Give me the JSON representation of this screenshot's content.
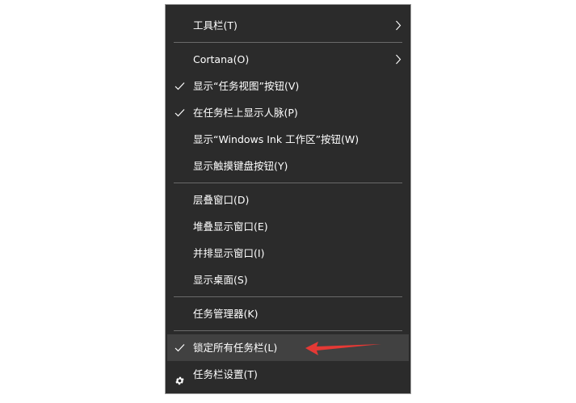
{
  "menu": {
    "groups": [
      [
        {
          "label": "工具栏(T)",
          "checked": false,
          "submenu": true
        }
      ],
      [
        {
          "label": "Cortana(O)",
          "checked": false,
          "submenu": true
        },
        {
          "label": "显示“任务视图”按钮(V)",
          "checked": true,
          "submenu": false
        },
        {
          "label": "在任务栏上显示人脉(P)",
          "checked": true,
          "submenu": false
        },
        {
          "label": "显示“Windows Ink 工作区”按钮(W)",
          "checked": false,
          "submenu": false
        },
        {
          "label": "显示触摸键盘按钮(Y)",
          "checked": false,
          "submenu": false
        }
      ],
      [
        {
          "label": "层叠窗口(D)",
          "checked": false,
          "submenu": false
        },
        {
          "label": "堆叠显示窗口(E)",
          "checked": false,
          "submenu": false
        },
        {
          "label": "并排显示窗口(I)",
          "checked": false,
          "submenu": false
        },
        {
          "label": "显示桌面(S)",
          "checked": false,
          "submenu": false
        }
      ],
      [
        {
          "label": "任务管理器(K)",
          "checked": false,
          "submenu": false
        }
      ],
      [
        {
          "label": "锁定所有任务栏(L)",
          "checked": true,
          "submenu": false,
          "highlighted": true
        },
        {
          "label": "任务栏设置(T)",
          "checked": false,
          "submenu": false,
          "icon": "gear-icon"
        }
      ]
    ]
  },
  "colors": {
    "menu_bg": "#2b2b2b",
    "highlight_bg": "#414141",
    "text": "#ffffff",
    "separator": "#6a6a6a",
    "annotation_arrow": "#e53935"
  },
  "annotation": {
    "icon": "red-arrow-icon"
  }
}
